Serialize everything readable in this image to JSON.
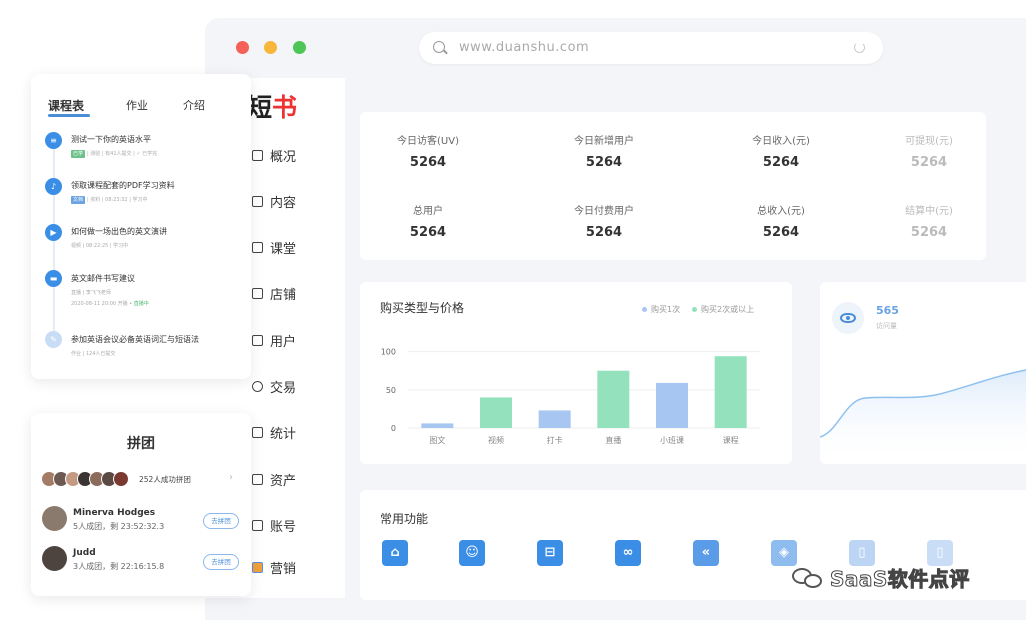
{
  "browser": {
    "url": "www.duanshu.com"
  },
  "logo": {
    "text_main": "短",
    "text_accent": "书"
  },
  "nav": {
    "items": [
      {
        "label": "概况",
        "icon": "overview-icon"
      },
      {
        "label": "内容",
        "icon": "content-icon"
      },
      {
        "label": "课堂",
        "icon": "classroom-icon"
      },
      {
        "label": "店铺",
        "icon": "store-icon"
      },
      {
        "label": "用户",
        "icon": "user-icon"
      },
      {
        "label": "交易",
        "icon": "transaction-icon"
      },
      {
        "label": "统计",
        "icon": "statistics-icon"
      },
      {
        "label": "资产",
        "icon": "assets-icon"
      },
      {
        "label": "账号",
        "icon": "account-icon"
      },
      {
        "label": "营销",
        "icon": "marketing-icon"
      }
    ]
  },
  "stats": [
    {
      "label": "今日访客(UV)",
      "value": "5264"
    },
    {
      "label": "今日新增用户",
      "value": "5264"
    },
    {
      "label": "今日收入(元)",
      "value": "5264"
    },
    {
      "label": "可提现(元)",
      "value": "5264"
    },
    {
      "label": "总用户",
      "value": "5264"
    },
    {
      "label": "今日付费用户",
      "value": "5264"
    },
    {
      "label": "总收入(元)",
      "value": "5264"
    },
    {
      "label": "结算中(元)",
      "value": "5264"
    }
  ],
  "chart_data": {
    "type": "bar",
    "title": "购买类型与价格",
    "categories": [
      "图文",
      "视频",
      "打卡",
      "直播",
      "小班课",
      "课程"
    ],
    "values": [
      6,
      40,
      23,
      75,
      59,
      94
    ],
    "bar_colors": [
      "#a8c6f2",
      "#93e2bd",
      "#a8c6f2",
      "#93e2bd",
      "#a8c6f2",
      "#93e2bd"
    ],
    "legend": [
      {
        "name": "购买1次",
        "color": "#a8c6f2"
      },
      {
        "name": "购买2次或以上",
        "color": "#93e2bd"
      }
    ],
    "yticks": [
      0,
      50,
      100
    ],
    "ylim": [
      0,
      110
    ],
    "grid": true,
    "legend_position": "top-right"
  },
  "visits": {
    "value": "565",
    "label": "访问量"
  },
  "functions": {
    "title": "常用功能",
    "icons": [
      {
        "name": "publish-icon",
        "glyph": "⌂",
        "color": "#3a8ee6"
      },
      {
        "name": "member-icon",
        "glyph": "☺",
        "color": "#3a8ee6"
      },
      {
        "name": "scan-icon",
        "glyph": "⊟",
        "color": "#3a8ee6"
      },
      {
        "name": "link-icon",
        "glyph": "∞",
        "color": "#3a8ee6"
      },
      {
        "name": "code-icon",
        "glyph": "«",
        "color": "#5a9ce8"
      },
      {
        "name": "package-icon",
        "glyph": "◈",
        "color": "#8fbcef"
      },
      {
        "name": "doc-icon",
        "glyph": "▯",
        "color": "#bcd5f5"
      },
      {
        "name": "page-icon",
        "glyph": "▯",
        "color": "#c9ddf7"
      }
    ]
  },
  "course": {
    "tabs": [
      "课程表",
      "作业",
      "介绍"
    ],
    "items": [
      {
        "icon": "quiz-icon",
        "glyph": "≡",
        "title": "测试一下你的英语水平",
        "meta": "|  测验  |  有41人提交  |  ✓ 已学完",
        "tag": "已学",
        "tag_color": "green"
      },
      {
        "icon": "audio-icon",
        "glyph": "♪",
        "title": "领取课程配套的PDF学习资料",
        "meta": "|  资料  |  08:23:32  |  学习中",
        "tag": "文档",
        "tag_color": "blue"
      },
      {
        "icon": "video-icon",
        "glyph": "▶",
        "title": "如何做一场出色的英文演讲",
        "meta": "视频 | 08:22:25 | 学习中",
        "tag": "",
        "tag_color": ""
      },
      {
        "icon": "live-icon",
        "glyph": "▬",
        "title": "英文邮件书写建议",
        "meta": "直播 | 李飞飞老师",
        "meta2": "2020-08-11 20:00 开播  •",
        "live": "直播中",
        "tag": "",
        "tag_color": ""
      },
      {
        "icon": "homework-icon",
        "glyph": "✎",
        "title": "参加英语会议必备英语词汇与短语法",
        "meta": "作业 | 124人已提交",
        "tag": "",
        "tag_color": ""
      }
    ]
  },
  "group": {
    "title": "拼团",
    "count_text": "252人成功拼团",
    "avatar_colors": [
      "#a47c66",
      "#6d5a52",
      "#c49a82",
      "#3a3432",
      "#8b6c5c",
      "#5b4a44",
      "#7a3a30"
    ],
    "members": [
      {
        "name": "Minerva Hodges",
        "info": "5人成团，剩 23:52:32.3",
        "button": "去拼团"
      },
      {
        "name": "Judd",
        "info": "3人成团，剩 22:16:15.8",
        "button": "去拼团"
      }
    ]
  },
  "watermark": {
    "text": "SaaS软件点评"
  }
}
